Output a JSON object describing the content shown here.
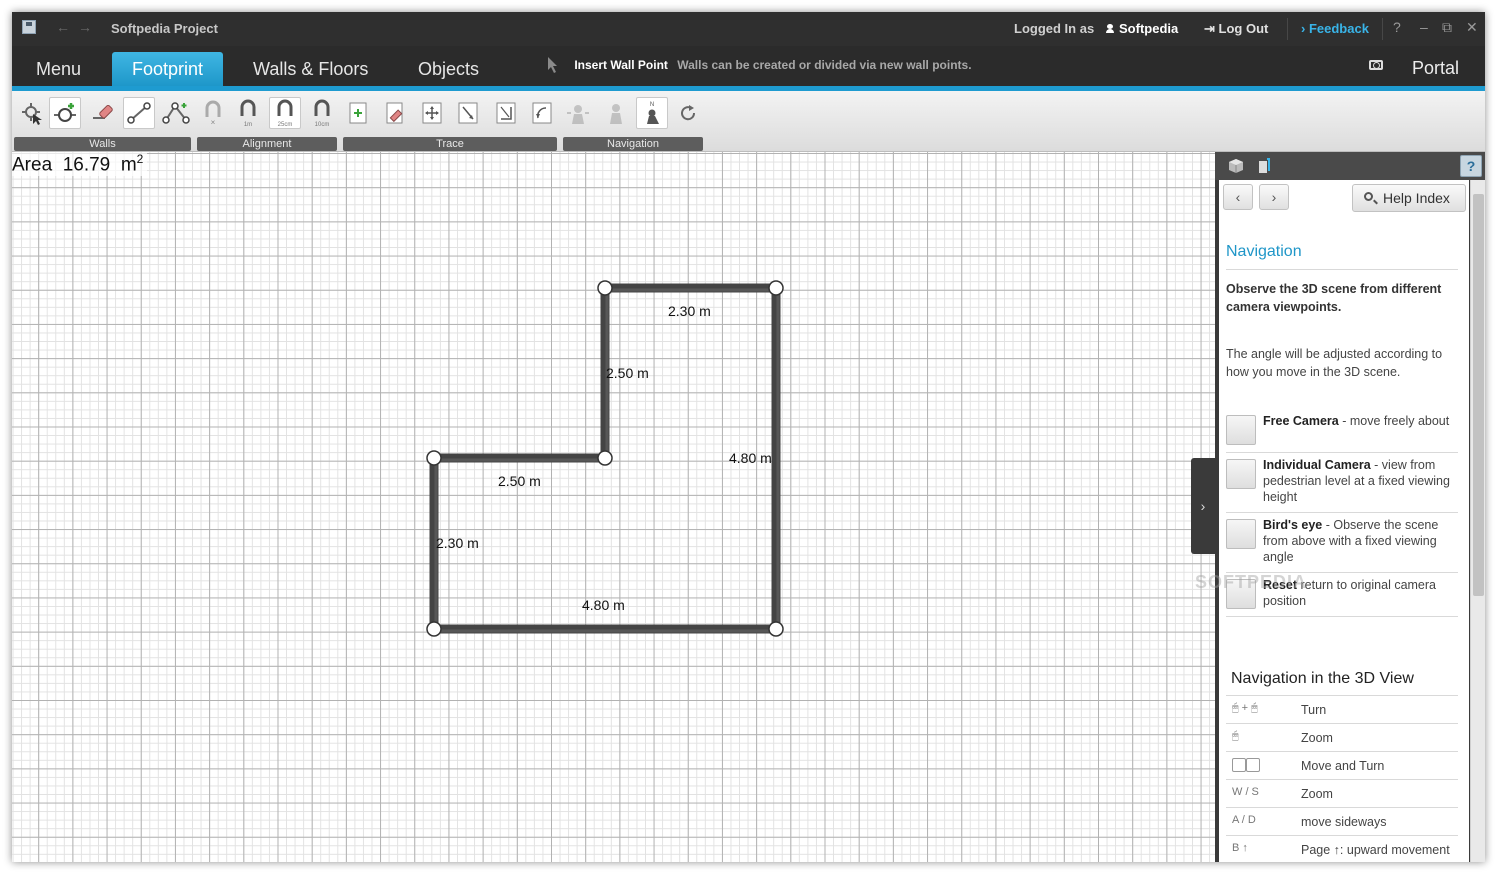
{
  "titlebar": {
    "title": "Softpedia Project",
    "logged_in_as": "Logged In as",
    "username": "Softpedia",
    "logout": "Log Out",
    "feedback": "Feedback",
    "help": "?",
    "minimize": "–",
    "restore": "⧉",
    "close": "✕",
    "back_arrow": "←",
    "forward_arrow": "→",
    "feedback_chevron": "›",
    "logout_icon": "⇥"
  },
  "menubar": {
    "tabs": [
      "Menu",
      "Footprint",
      "Walls & Floors",
      "Objects"
    ],
    "active_tab": "Footprint",
    "hint_title": "Insert Wall Point",
    "hint_desc": "Walls can be created or divided via new wall points.",
    "portal": "Portal"
  },
  "toolbar": {
    "groups": [
      "Walls",
      "Alignment",
      "Trace",
      "Navigation"
    ],
    "tools": [
      {
        "name": "select-tool-icon"
      },
      {
        "name": "insert-wall-point-icon"
      },
      {
        "name": "eraser-icon"
      },
      {
        "name": "draw-wall-icon"
      },
      {
        "name": "wall-chain-icon"
      },
      {
        "name": "magnet-off-icon"
      },
      {
        "name": "magnet-1m-icon",
        "label": "1m"
      },
      {
        "name": "magnet-25cm-icon",
        "label": "25cm"
      },
      {
        "name": "magnet-10cm-icon",
        "label": "10cm"
      },
      {
        "name": "trace-add-icon"
      },
      {
        "name": "trace-edit-icon"
      },
      {
        "name": "trace-move-icon"
      },
      {
        "name": "trace-resize-a-icon"
      },
      {
        "name": "trace-resize-b-icon"
      },
      {
        "name": "trace-rotate-icon"
      },
      {
        "name": "free-camera-icon"
      },
      {
        "name": "individual-camera-icon"
      },
      {
        "name": "birds-eye-icon"
      },
      {
        "name": "reset-camera-icon"
      }
    ]
  },
  "canvas": {
    "area_label": "Area",
    "area_value": "16.79",
    "area_unit": "m",
    "area_sup": "2",
    "dimensions": [
      "2.30  m",
      "2.50  m",
      "4.80  m",
      "2.50  m",
      "2.30  m",
      "4.80  m"
    ]
  },
  "panel": {
    "help_index": "Help Index",
    "heading": "Navigation",
    "lead": "Observe the 3D scene from different camera viewpoints.",
    "body": "The angle will be adjusted according to how you move in the 3D scene.",
    "items": [
      {
        "title": "Free Camera",
        "desc": "- move freely about"
      },
      {
        "title": "Individual Camera",
        "desc": " - view from pedestrian level at a fixed viewing height"
      },
      {
        "title": "Bird's eye",
        "desc": " - Observe the scene from above with a fixed viewing angle"
      },
      {
        "title": "Reset",
        "desc": " return to original camera position"
      }
    ],
    "section_title": "Navigation in the 3D View",
    "controls": [
      {
        "keys": "+",
        "label": "Turn"
      },
      {
        "keys": "",
        "label": "Zoom"
      },
      {
        "keys": "",
        "label": "Move and Turn"
      },
      {
        "keys": "W / S",
        "label": "Zoom"
      },
      {
        "keys": "A / D",
        "label": "move sideways"
      },
      {
        "keys": "B ↑",
        "label": "Page ↑: upward movement"
      }
    ],
    "watermark": "SOFTPEDIA"
  }
}
